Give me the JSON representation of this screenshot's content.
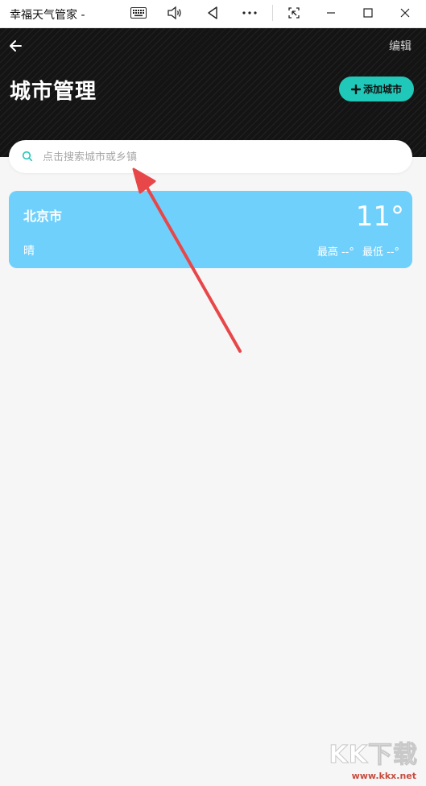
{
  "window": {
    "title": "幸福天气管家 -",
    "icons": [
      "keyboard-icon",
      "volume-icon",
      "back-triangle-icon",
      "more-icon",
      "snip-icon",
      "minimize-icon",
      "maximize-icon",
      "close-icon"
    ]
  },
  "header": {
    "back_icon": "arrow-left-icon",
    "edit_label": "编辑",
    "title": "城市管理",
    "add_city_label": "添加城市",
    "add_city_color": "#1fc8b8"
  },
  "search": {
    "placeholder": "点击搜索城市或乡镇",
    "value": ""
  },
  "cities": [
    {
      "name": "北京市",
      "temperature": "11°",
      "weather": "晴",
      "high_label": "最高 --°",
      "low_label": "最低 --°",
      "card_color": "#6fd0fb"
    }
  ],
  "annotation": {
    "arrow_color": "#e8474a"
  },
  "watermark": {
    "main": "KK下载",
    "sub": "www.kkx.net"
  }
}
